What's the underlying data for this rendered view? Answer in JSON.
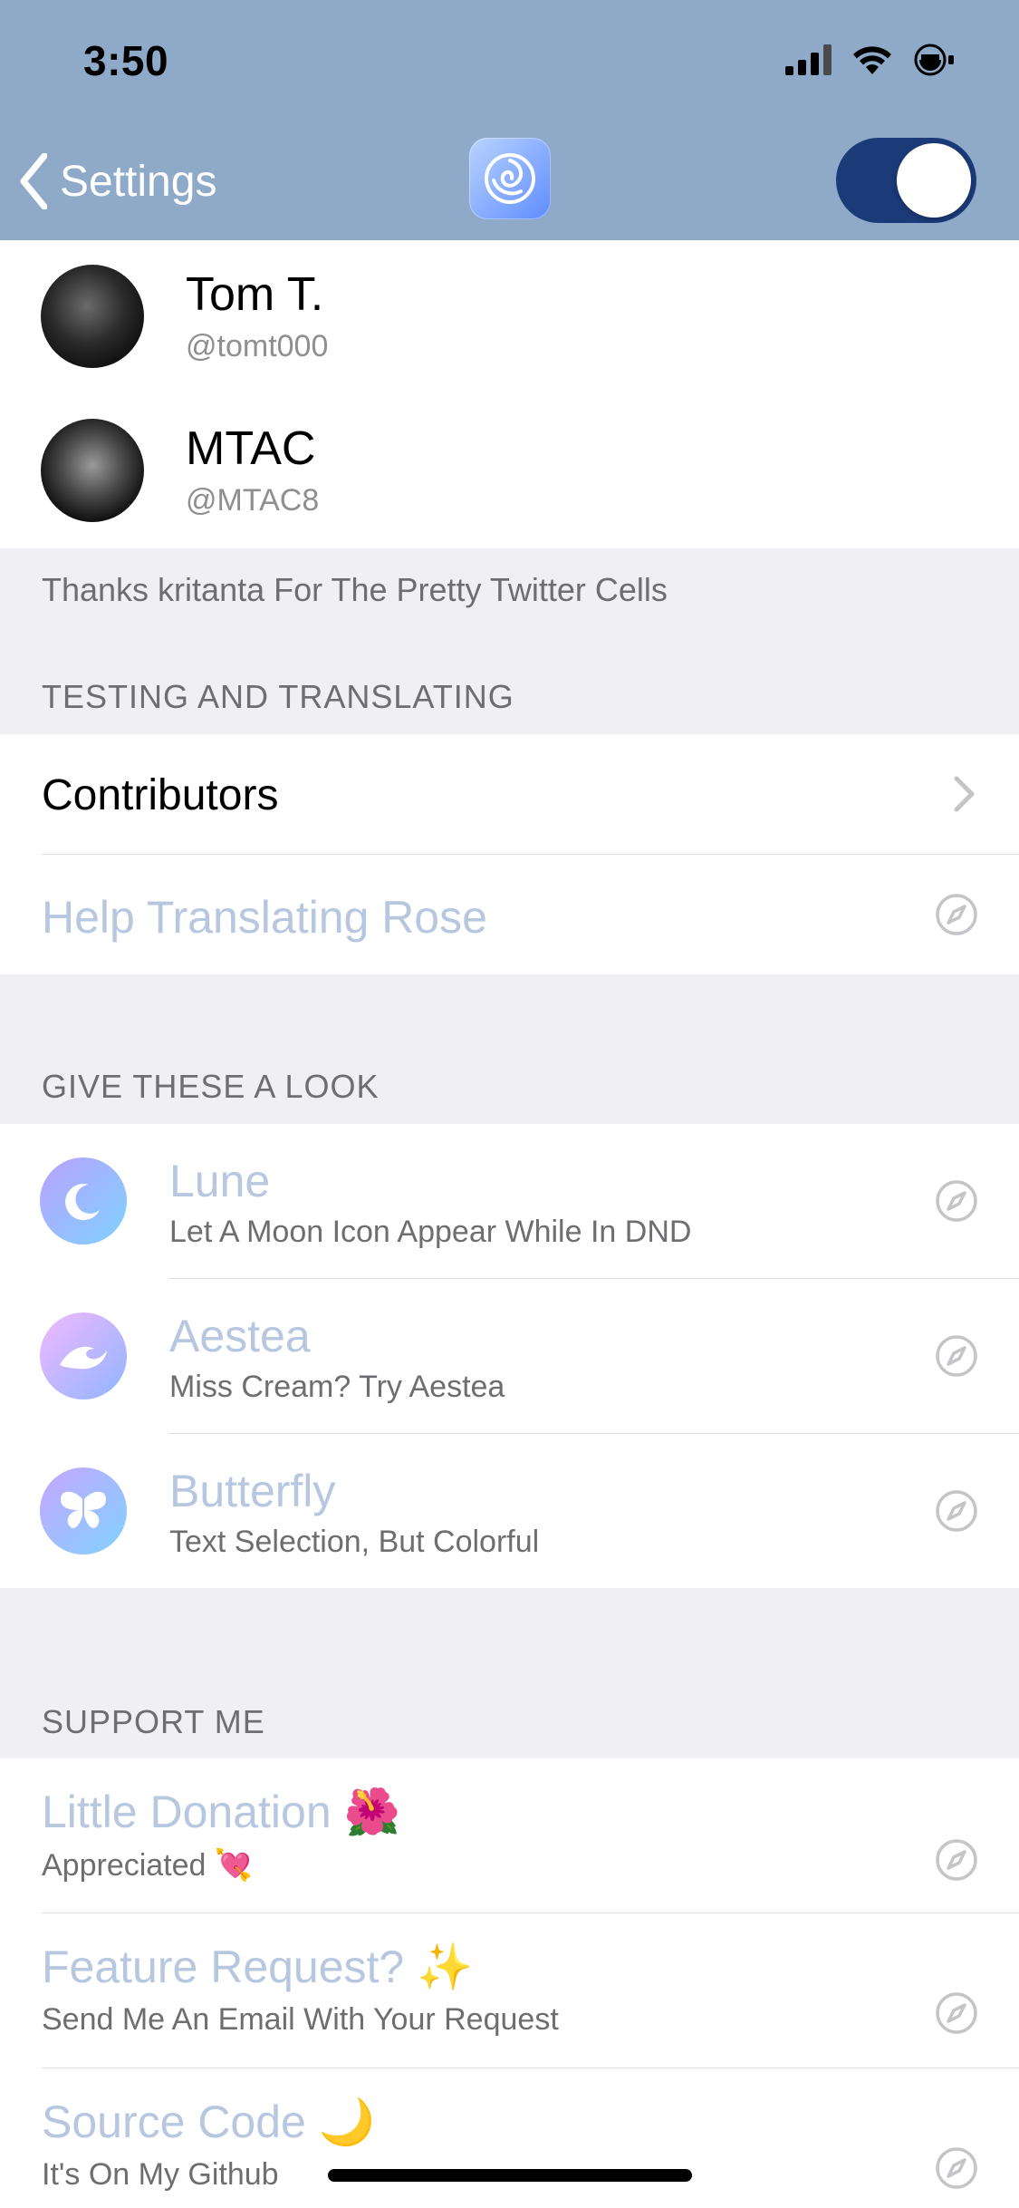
{
  "status_bar": {
    "time": "3:50"
  },
  "nav": {
    "back_label": "Settings",
    "toggle_on": true,
    "colors": {
      "bar": "#8faac9",
      "toggle": "#1b3a78"
    }
  },
  "twitter_cells": [
    {
      "name": "Tom T.",
      "handle": "@tomt000"
    },
    {
      "name": "MTAC",
      "handle": "@MTAC8"
    }
  ],
  "credits_footer": "Thanks kritanta For The Pretty Twitter Cells",
  "testing_section": {
    "header": "TESTING AND TRANSLATING",
    "contributors_label": "Contributors",
    "help_label": "Help Translating Rose"
  },
  "look_section": {
    "header": "GIVE THESE A LOOK",
    "items": [
      {
        "title": "Lune",
        "subtitle": "Let A Moon Icon Appear While In DND",
        "icon": "moon-icon"
      },
      {
        "title": "Aestea",
        "subtitle": "Miss Cream? Try Aestea",
        "icon": "wave-icon"
      },
      {
        "title": "Butterfly",
        "subtitle": "Text Selection, But Colorful",
        "icon": "butterfly-icon"
      }
    ]
  },
  "support_section": {
    "header": "SUPPORT ME",
    "items": [
      {
        "title": "Little Donation 🌺",
        "subtitle": "Appreciated 💘"
      },
      {
        "title": "Feature Request? ✨",
        "subtitle": "Send Me An Email With Your Request"
      },
      {
        "title": "Source Code 🌙",
        "subtitle": "It's On My Github"
      }
    ]
  }
}
